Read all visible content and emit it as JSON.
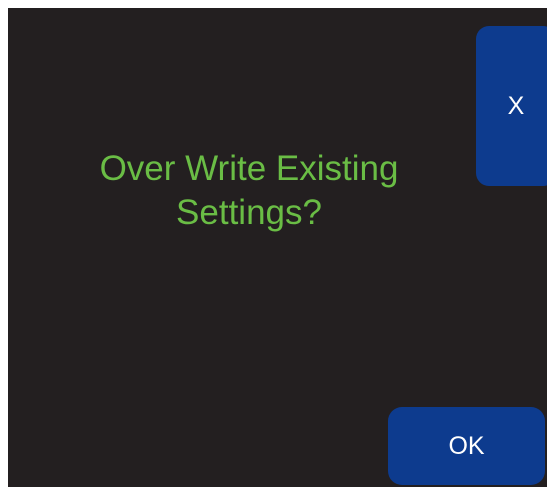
{
  "dialog": {
    "message_line1": "Over Write Existing",
    "message_line2": "Settings?",
    "close_label": "X",
    "ok_label": "OK"
  },
  "colors": {
    "background": "#231f20",
    "message_text": "#6abd45",
    "button": "#0d3b8e",
    "button_text": "#ffffff"
  }
}
